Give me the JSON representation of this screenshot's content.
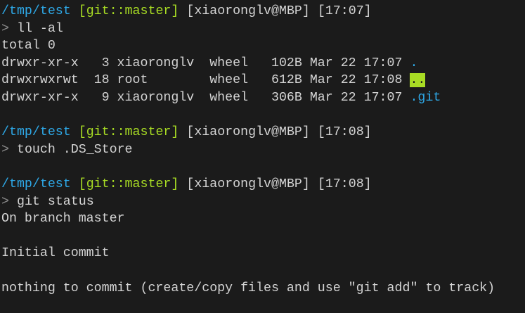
{
  "prompts": [
    {
      "path": "/tmp/test",
      "branch": "[git::master]",
      "host": "[xiaoronglv@MBP]",
      "time": "[17:07]",
      "command": "ll -al"
    },
    {
      "path": "/tmp/test",
      "branch": "[git::master]",
      "host": "[xiaoronglv@MBP]",
      "time": "[17:08]",
      "command": "touch .DS_Store"
    },
    {
      "path": "/tmp/test",
      "branch": "[git::master]",
      "host": "[xiaoronglv@MBP]",
      "time": "[17:08]",
      "command": "git status"
    }
  ],
  "prompt_symbol": ">",
  "ls": {
    "total": "total 0",
    "rows": [
      {
        "info": "drwxr-xr-x   3 xiaoronglv  wheel   102B Mar 22 17:07 ",
        "name": "."
      },
      {
        "info": "drwxrwxrwt  18 root        wheel   612B Mar 22 17:08 ",
        "name": ".."
      },
      {
        "info": "drwxr-xr-x   9 xiaoronglv  wheel   306B Mar 22 17:07 ",
        "name": ".git"
      }
    ]
  },
  "status": {
    "branch": "On branch master",
    "initial": "Initial commit",
    "nothing": "nothing to commit (create/copy files and use \"git add\" to track)"
  },
  "colors": {
    "path": "#2ea9e8",
    "branch": "#a8dc24",
    "background": "#1b1b1b"
  }
}
